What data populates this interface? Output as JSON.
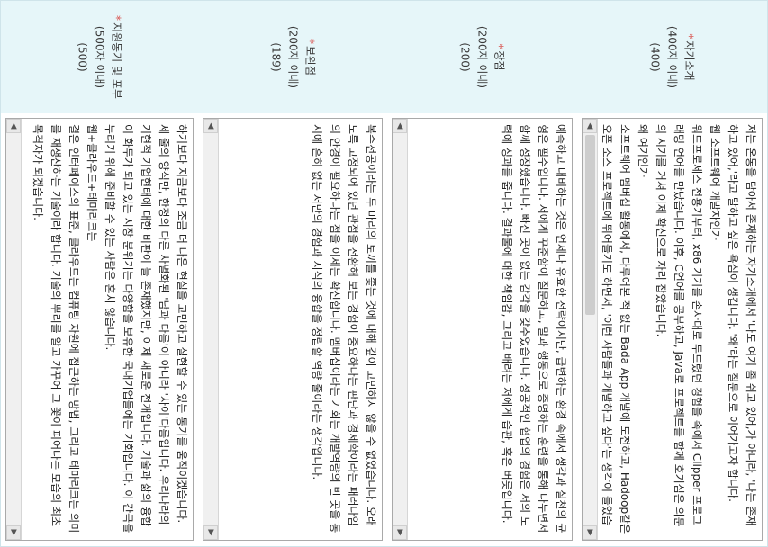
{
  "fields": [
    {
      "title": "자기소개",
      "limit": "(400자 이내)",
      "count": "(400)",
      "text": "저는 온통을 담아서 존재하는 자기소개에서 '나도 여기 좀 쉬고 있어,가 아니라, '나는 존재하고 있어,'라고 말하고 싶은 욕심이 생깁니다. '왜'라는 질문으로 이어가고자 합니다.\n웹 소프트웨어 개발자인가\n워드프로세스 전용기부터, x86 기기를 손사대로 두드렸던 경험을 속에서 Clipper 프로그래밍 언어를 만났습니다. 이후, C언어를 공부하고, Java로 프로젝트를 함께 호기심은 의문의 시기를 거쳐 이제 확신으로 자리 잡았습니다.\n왜 여기인가\n소프트웨어 멤버십 활동에서, 다루어본 적 없는 Bada App 개발에 도전하고, Hadoop같은 오픈 소스 프로젝트에 뛰어들기도 하면서, '이런 사람들과 개발하고 싶다'는 생각이 들었습니다. 사람을 향하는 개발자의 모습을 상상하고 고민합니다."
    },
    {
      "title": "장점",
      "limit": "(200자 이내)",
      "count": "(200)",
      "text": "예측하고 대비하는 것은 언제나 유효한 전략이지만, 급변하는 환경 속에서 생각과 실천의 균형은 필수입니다. 저에게 꾸준함이 질문하고, 말과 행동으로 증명하는 훈련을 통해 나누면서 함께 성장했습니다. 빠진 곳이 없는 감각을 갖추었습니다. 성공적인 협업의 경험은 저의 노력에 성과를 줍니다. 결과물에 대한 책임감, 그리고 배려는 저에게 습관, 혹은 버릇입니다."
    },
    {
      "title": "보완점",
      "limit": "(200자 이내)",
      "count": "(189)",
      "text": "복수전공이라는 두 마리의 토끼를 쫓는 것에 대해 깊이 고민하지 않을 수 없었습니다. 오래도록 고정되어 있던 관점을 전환해 보는 경험이 중요하다는 판단과 경제학이라는 패러다임의 안경이 필요하다는 점을 이제는 확신합니다. 멤버십이라는 기회는 개발역량의 빈 곳을 동시에 흔히 없는 저만의 경험과 지식의 융합을 정립할 역량 줄이라는 생각입니다."
    },
    {
      "title": "지원동기 및 포부",
      "limit": "(500자 이내)",
      "count": "(500)",
      "text": "하기보다 지금보다 조금 더 나은 현실을 고민하고 실현할 수 있는 동기를 움직이겠습니다.\n세 줄의 양식만, 한정의 다른 차별화된 '남과 다름'이 아니라 '차이'다름입니다. 우리나라의 기현적 기업현태에 대한 비판이 늘 존재했지만, 이제 새로운 전개입니다. 기술과 삶의 융합이 화두가 되고 있는 시장 분위기는 다양함을 보유한 국내기업들에는 기회입니다. 이 간극을 누리기 위해 준비할 수 있는 사람은 혼치 않습니다.\n웹+클라우드+테마리크는\n결은 인터페이스의 표준, 클라우드는 컴퓨팅 자원에 접근하는 방법, 그리고 테마리크는 의미를 재생산하는 기술이라 합니다. 기술의 뿌리를 알고 가꾸어 그 꽃이 피어나는 모습의 최초 목격자가 되겠습니다."
    }
  ],
  "scroll_left_icon": "triangle-left-icon",
  "scroll_right_icon": "triangle-right-icon"
}
